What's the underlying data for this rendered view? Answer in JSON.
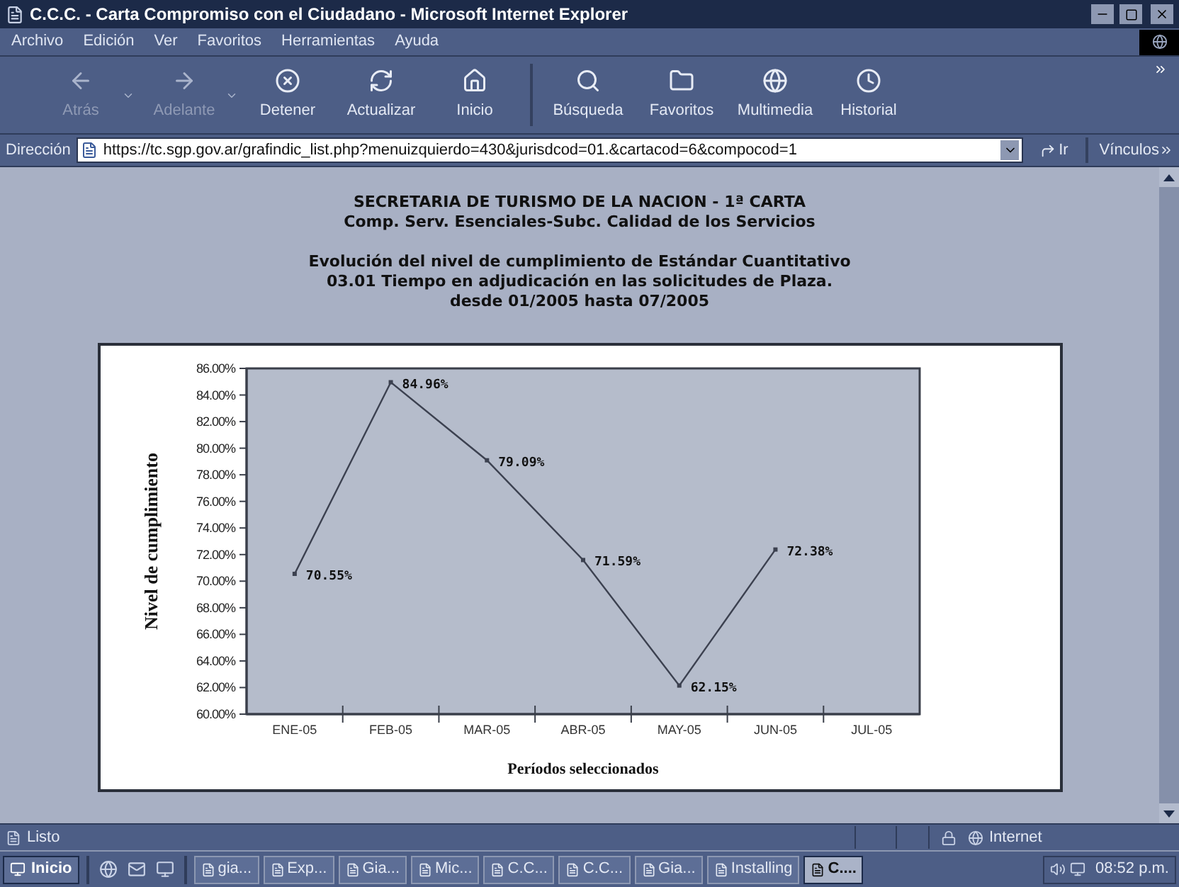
{
  "window": {
    "title": "C.C.C. - Carta Compromiso con el Ciudadano - Microsoft Internet Explorer"
  },
  "menu": [
    "Archivo",
    "Edición",
    "Ver",
    "Favoritos",
    "Herramientas",
    "Ayuda"
  ],
  "toolbar": [
    {
      "kind": "back",
      "label": "Atrás",
      "disabled": true,
      "dropdown": true
    },
    {
      "kind": "forward",
      "label": "Adelante",
      "disabled": true,
      "dropdown": true
    },
    {
      "kind": "stop",
      "label": "Detener",
      "disabled": false,
      "dropdown": false
    },
    {
      "kind": "refresh",
      "label": "Actualizar",
      "disabled": false,
      "dropdown": false
    },
    {
      "kind": "home",
      "label": "Inicio",
      "disabled": false,
      "dropdown": false
    },
    {
      "kind": "search",
      "label": "Búsqueda",
      "disabled": false,
      "dropdown": false
    },
    {
      "kind": "favorites",
      "label": "Favoritos",
      "disabled": false,
      "dropdown": false
    },
    {
      "kind": "media",
      "label": "Multimedia",
      "disabled": false,
      "dropdown": false
    },
    {
      "kind": "history",
      "label": "Historial",
      "disabled": false,
      "dropdown": false
    }
  ],
  "address_bar": {
    "label": "Dirección",
    "value": "https://tc.sgp.gov.ar/grafindic_list.php?menuizquierdo=430&jurisdcod=01.&cartacod=6&compocod=1",
    "go": "Ir",
    "links": "Vínculos"
  },
  "page": {
    "heading": [
      "SECRETARIA DE TURISMO DE LA NACION - 1ª CARTA",
      "Comp. Serv. Esenciales-Subc. Calidad de los Servicios"
    ],
    "subheading": [
      "Evolución del nivel de cumplimiento de Estándar Cuantitativo",
      "03.01 Tiempo en adjudicación en las solicitudes de Plaza.",
      "desde 01/2005 hasta 07/2005"
    ],
    "chart_data": {
      "type": "line",
      "xlabel": "Períodos seleccionados",
      "ylabel": "Nivel de cumplimiento",
      "categories": [
        "ENE-05",
        "FEB-05",
        "MAR-05",
        "ABR-05",
        "MAY-05",
        "JUN-05",
        "JUL-05"
      ],
      "series": [
        {
          "color": "#3c4150",
          "marker": true,
          "values": [
            70.55,
            84.96,
            79.09,
            71.59,
            62.15,
            72.38,
            null
          ]
        }
      ],
      "value_labels": [
        "70.55%",
        "84.96%",
        "79.09%",
        "71.59%",
        "62.15%",
        "72.38%"
      ],
      "ylim": [
        60,
        86
      ],
      "yticks": [
        {
          "value": 60,
          "label": "60.00%"
        },
        {
          "value": 62,
          "label": "62.00%"
        },
        {
          "value": 64,
          "label": "64.00%"
        },
        {
          "value": 66,
          "label": "66.00%"
        },
        {
          "value": 68,
          "label": "68.00%"
        },
        {
          "value": 70,
          "label": "70.00%"
        },
        {
          "value": 72,
          "label": "72.00%"
        },
        {
          "value": 74,
          "label": "74.00%"
        },
        {
          "value": 76,
          "label": "76.00%"
        },
        {
          "value": 78,
          "label": "78.00%"
        },
        {
          "value": 80,
          "label": "80.00%"
        },
        {
          "value": 82,
          "label": "82.00%"
        },
        {
          "value": 84,
          "label": "84.00%"
        },
        {
          "value": 86,
          "label": "86.00%"
        }
      ]
    }
  },
  "status_bar": {
    "text": "Listo",
    "zone": "Internet"
  },
  "taskbar": {
    "start": "Inicio",
    "tasks": [
      {
        "label": "gia...",
        "selected": false
      },
      {
        "label": "Exp...",
        "selected": false
      },
      {
        "label": "Gia...",
        "selected": false
      },
      {
        "label": "Mic...",
        "selected": false
      },
      {
        "label": "C.C...",
        "selected": false
      },
      {
        "label": "C.C...",
        "selected": false
      },
      {
        "label": "Gia...",
        "selected": false
      },
      {
        "label": "Installing",
        "selected": false
      },
      {
        "label": "C....",
        "selected": true
      }
    ],
    "clock": "08:52 p.m."
  }
}
